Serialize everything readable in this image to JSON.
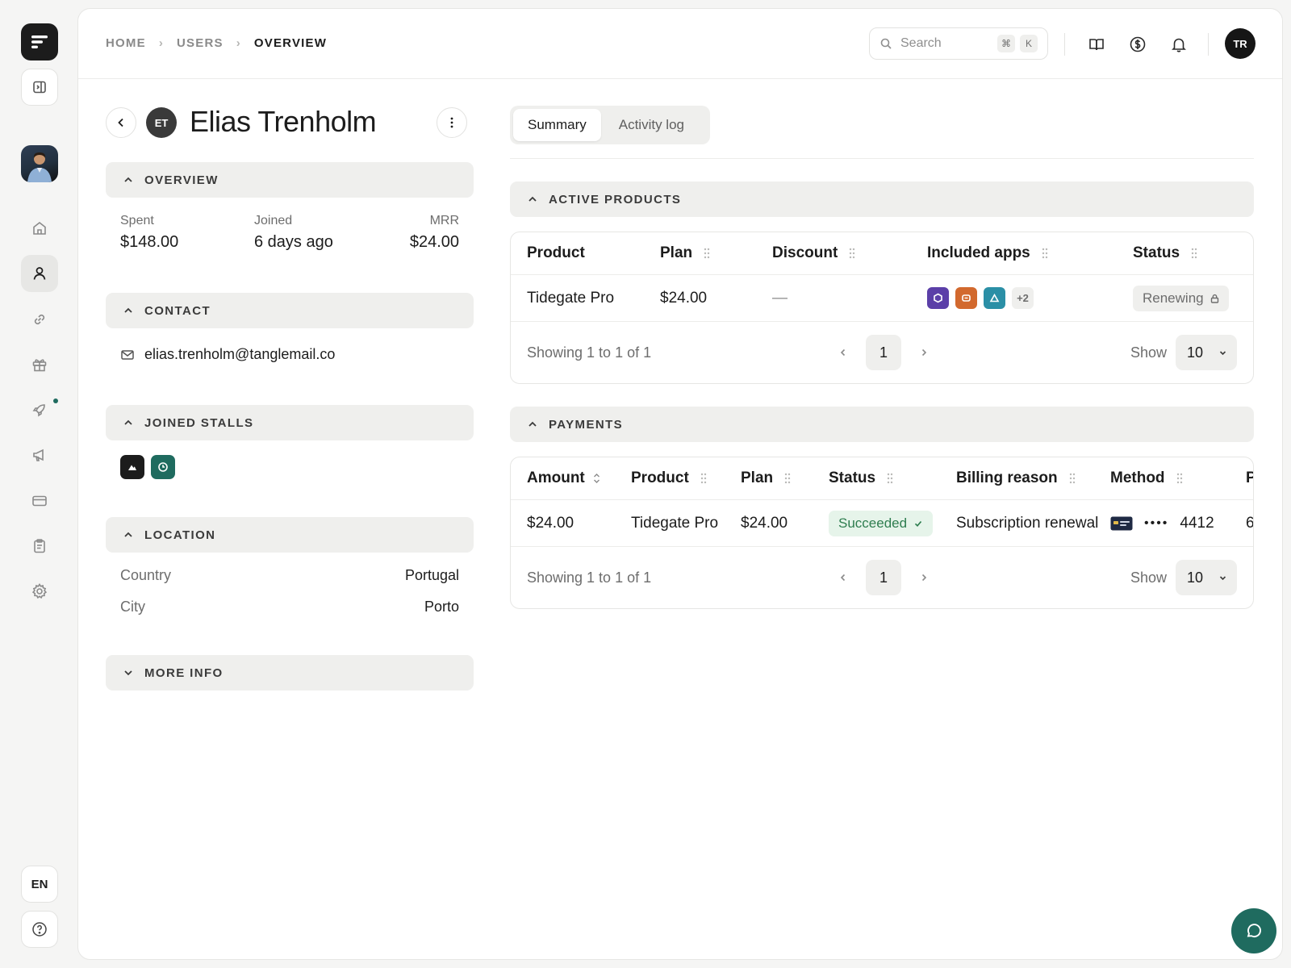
{
  "breadcrumb": {
    "items": [
      "HOME",
      "USERS",
      "OVERVIEW"
    ]
  },
  "search": {
    "placeholder": "Search",
    "shortcut_mod": "⌘",
    "shortcut_key": "K"
  },
  "topbar": {
    "avatar_initials": "TR",
    "icons": [
      "book-icon",
      "dollar-coin-icon",
      "bell-icon"
    ]
  },
  "rail": {
    "nav_icons": [
      "home-icon",
      "user-icon",
      "link-icon",
      "gift-icon",
      "rocket-icon",
      "megaphone-icon",
      "credit-card-icon",
      "clipboard-icon",
      "gear-icon"
    ],
    "active_item": "user-icon",
    "notification_on": "rocket-icon",
    "language": "EN"
  },
  "user": {
    "initials": "ET",
    "name": "Elias Trenholm"
  },
  "overview": {
    "title": "OVERVIEW",
    "spent_label": "Spent",
    "spent_value": "$148.00",
    "joined_label": "Joined",
    "joined_value": "6 days ago",
    "mrr_label": "MRR",
    "mrr_value": "$24.00"
  },
  "contact": {
    "title": "CONTACT",
    "email": "elias.trenholm@tanglemail.co"
  },
  "joined_stalls": {
    "title": "JOINED STALLS",
    "stalls": [
      "mountain-stall-icon",
      "clock-stall-icon"
    ]
  },
  "location": {
    "title": "LOCATION",
    "country_label": "Country",
    "country_value": "Portugal",
    "city_label": "City",
    "city_value": "Porto"
  },
  "more_info": {
    "title": "MORE INFO"
  },
  "tabs": [
    {
      "label": "Summary",
      "active": true
    },
    {
      "label": "Activity log",
      "active": false
    }
  ],
  "active_products": {
    "title": "ACTIVE PRODUCTS",
    "columns": [
      "Product",
      "Plan",
      "Discount",
      "Included apps",
      "Status"
    ],
    "rows": [
      {
        "product": "Tidegate Pro",
        "plan": "$24.00",
        "discount": "—",
        "apps_extra": "+2",
        "status": "Renewing"
      }
    ],
    "footer_text": "Showing 1 to 1 of 1",
    "page": "1",
    "show_label": "Show",
    "page_size": "10"
  },
  "payments": {
    "title": "PAYMENTS",
    "columns": [
      "Amount",
      "Product",
      "Plan",
      "Status",
      "Billing reason",
      "Method",
      "P"
    ],
    "rows": [
      {
        "amount": "$24.00",
        "product": "Tidegate Pro",
        "plan": "$24.00",
        "status": "Succeeded",
        "billing_reason": "Subscription renewal",
        "method_dots": "••••",
        "method_last4": "4412",
        "clipped": "6"
      }
    ],
    "footer_text": "Showing 1 to 1 of 1",
    "page": "1",
    "show_label": "Show",
    "page_size": "10"
  },
  "colors": {
    "accent": "#1f6b5f",
    "success_bg": "#e6f4ea",
    "success_text": "#2e7d4f",
    "app_purple": "#5b3fa8",
    "app_orange": "#d2692e",
    "app_teal": "#2b8fa6"
  }
}
